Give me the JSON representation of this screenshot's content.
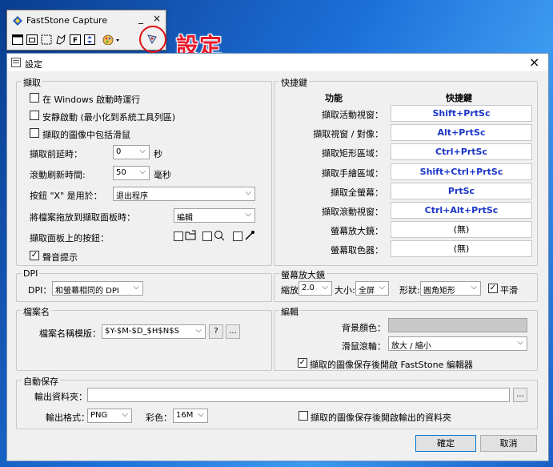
{
  "toolbar": {
    "title": "FastStone Capture",
    "minimize": "_",
    "close": "×"
  },
  "callout": "設定",
  "dialog": {
    "title": "設定",
    "close": "×",
    "capture": {
      "title": "擷取",
      "start_on_boot": "在 Windows 啟動時運行",
      "start_silent": "安靜啟動 (最小化到系統工具列區)",
      "include_cursor": "擷取的圖像中包括滑鼠",
      "delay_label": "擷取前延時：",
      "delay_value": "0",
      "delay_unit": "秒",
      "scroll_label": "滾動刷新時間:",
      "scroll_value": "50",
      "scroll_unit": "毫秒",
      "x_button_label": "按鈕 \"X\" 是用於：",
      "x_button_value": "退出程序",
      "drag_label": "將檔案拖放到擷取面板時：",
      "drag_value": "編輯",
      "panel_buttons_label": "擷取面板上的按鈕：",
      "sound_label": "聲音提示"
    },
    "hotkeys": {
      "title": "快捷鍵",
      "col_function": "功能",
      "col_hotkey": "快捷鍵",
      "rows": [
        {
          "label": "擷取活動視窗：",
          "key": "Shift+PrtSc"
        },
        {
          "label": "擷取視窗 / 對像：",
          "key": "Alt+PrtSc"
        },
        {
          "label": "擷取矩形區域：",
          "key": "Ctrl+PrtSc"
        },
        {
          "label": "擷取手繪區域：",
          "key": "Shift+Ctrl+PrtSc"
        },
        {
          "label": "擷取全螢幕：",
          "key": "PrtSc"
        },
        {
          "label": "擷取滾動視窗：",
          "key": "Ctrl+Alt+PrtSc"
        },
        {
          "label": "螢幕放大鏡：",
          "key": "(無)"
        },
        {
          "label": "螢幕取色器：",
          "key": "(無)"
        }
      ]
    },
    "dpi": {
      "title": "DPI",
      "label": "DPI：",
      "value": "和螢幕相同的 DPI"
    },
    "magnifier": {
      "title": "螢幕放大鏡",
      "zoom_label": "縮放:",
      "zoom_value": "2.0",
      "size_label": "大小:",
      "size_value": "全屏",
      "shape_label": "形狀:",
      "shape_value": "圓角矩形",
      "smooth_label": "平滑"
    },
    "filename": {
      "title": "檔案名",
      "label": "檔案名稱模版：",
      "value": "$Y-$M-$D_$H$N$S",
      "help": "?",
      "browse": "..."
    },
    "editor": {
      "title": "編輯",
      "bg_label": "背景顏色：",
      "bg_color": "#c8c8c8",
      "wheel_label": "滑鼠滾輪：",
      "wheel_value": "放大 / 縮小",
      "open_editor_label": "擷取的圖像保存後開啟 FastStone 編輯器"
    },
    "autosave": {
      "title": "自動保存",
      "folder_label": "輸出資料夾：",
      "folder_value": "",
      "browse": "...",
      "format_label": "輸出格式：",
      "format_value": "PNG",
      "color_label": "彩色：",
      "color_value": "16M",
      "open_folder_label": "擷取的圖像保存後開啟輸出的資料夾"
    },
    "ok": "確定",
    "cancel": "取消"
  }
}
